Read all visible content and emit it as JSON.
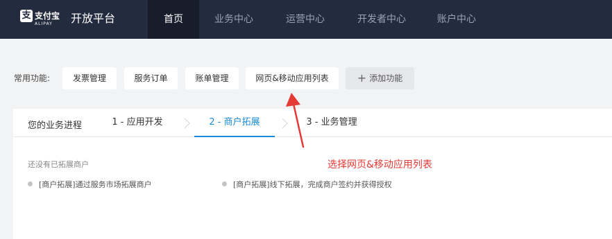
{
  "header": {
    "logo": {
      "cn": "支付宝",
      "en": "ALIPAY",
      "mark": "支"
    },
    "platform_title": "开放平台",
    "nav": [
      {
        "label": "首页",
        "active": true
      },
      {
        "label": "业务中心",
        "active": false
      },
      {
        "label": "运营中心",
        "active": false
      },
      {
        "label": "开发者中心",
        "active": false
      },
      {
        "label": "账户中心",
        "active": false
      }
    ]
  },
  "quick_functions": {
    "label": "常用功能:",
    "buttons": [
      "发票管理",
      "服务订单",
      "账单管理",
      "网页&移动应用列表"
    ],
    "add_label": "添加功能"
  },
  "progress": {
    "title": "您的业务进程",
    "steps": [
      {
        "label": "1 - 应用开发",
        "active": false
      },
      {
        "label": "2 - 商户拓展",
        "active": true
      },
      {
        "label": "3 - 业务管理",
        "active": false
      }
    ]
  },
  "merchant": {
    "empty_text": "还没有已拓展商户",
    "items": [
      "[商户拓展]通过服务市场拓展商户",
      "[商户拓展]线下拓展，完成商户签约并获得授权"
    ]
  },
  "annotation": {
    "text": "选择网页&移动应用列表",
    "color": "#e53935"
  },
  "colors": {
    "nav_bg": "#232b3e",
    "nav_active_bg": "#171d2b",
    "accent": "#1a8bd8",
    "page_bg": "#f2f3f5"
  }
}
